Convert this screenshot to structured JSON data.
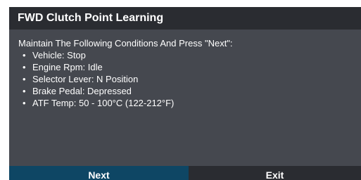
{
  "dialog": {
    "title": "FWD Clutch Point Learning",
    "instruction": "Maintain The Following Conditions And Press \"Next\":",
    "conditions": [
      "Vehicle: Stop",
      "Engine Rpm: Idle",
      "Selector Lever: N Position",
      "Brake Pedal: Depressed",
      "ATF Temp: 50 - 100°C (122-212°F)"
    ],
    "bullet": "•",
    "buttons": {
      "next": "Next",
      "exit": "Exit"
    }
  },
  "colors": {
    "header": "#2a2c31",
    "body": "#45484f",
    "next_button": "#0e4664",
    "exit_button": "#2a2c31",
    "text": "#ffffff"
  }
}
